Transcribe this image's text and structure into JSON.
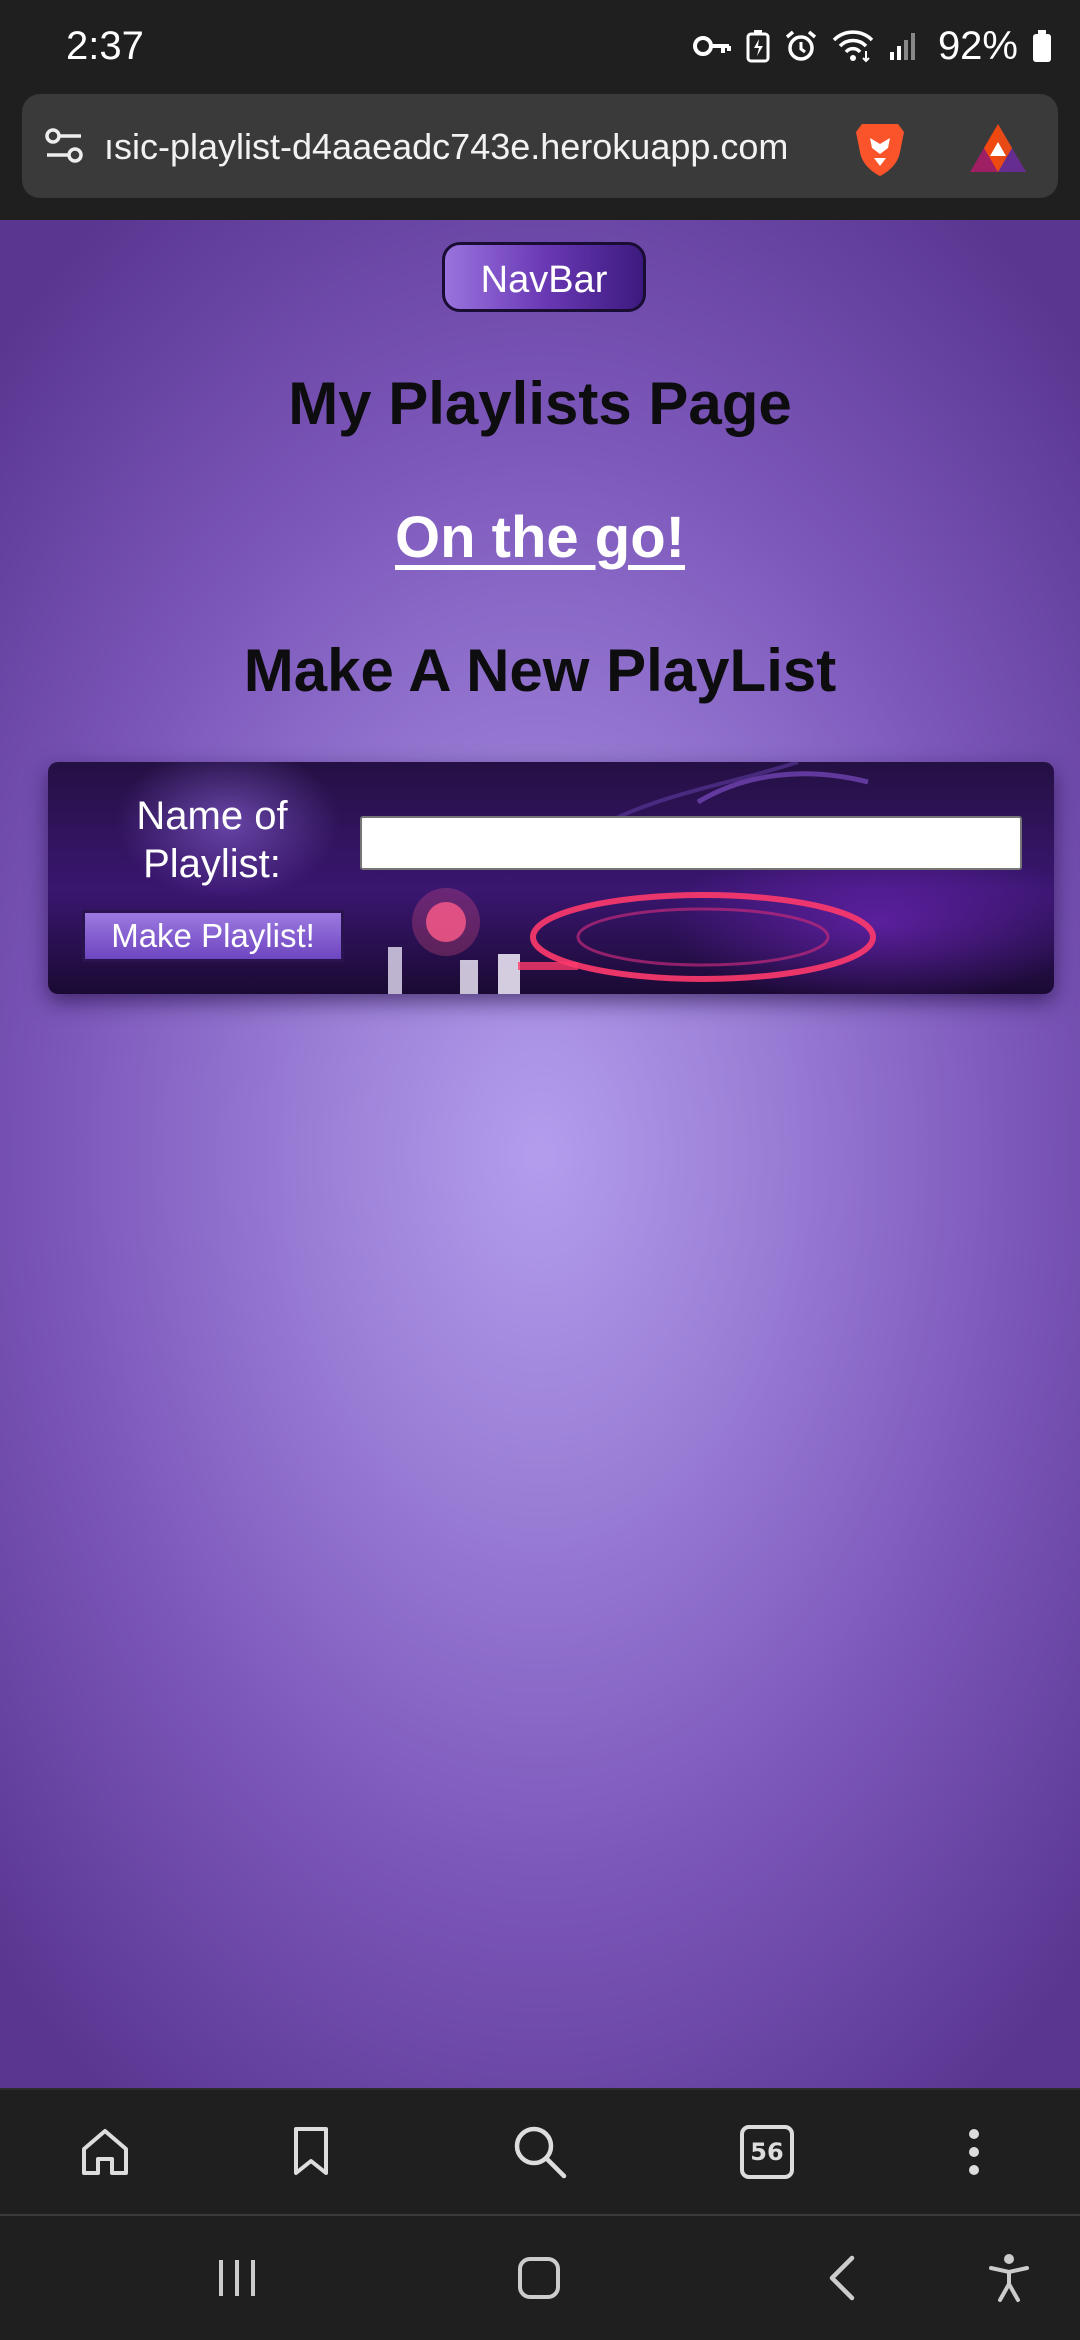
{
  "status_bar": {
    "time": "2:37",
    "battery_percent": "92%",
    "icons": [
      "key-icon",
      "battery-saver-icon",
      "alarm-icon",
      "wifi-icon",
      "cell-signal-icon",
      "battery-icon"
    ]
  },
  "browser": {
    "url": "ısic-playlist-d4aaeadc743e.herokuapp.com",
    "site_settings_icon": "tune-icon",
    "shields_icon": "brave-lion-icon",
    "rewards_icon": "brave-rewards-icon"
  },
  "page": {
    "nav_button": "NavBar",
    "title": "My Playlists Page",
    "subtitle_link": "On the go!",
    "section_heading": "Make A New PlayList",
    "form": {
      "name_label": "Name of Playlist:",
      "name_value": "",
      "submit_label": "Make Playlist!"
    }
  },
  "toolbar": {
    "items": [
      "home-icon",
      "bookmark-icon",
      "search-icon",
      "tabs-icon",
      "more-icon"
    ],
    "tab_count": "56"
  },
  "system_nav": {
    "items": [
      "recent-apps-icon",
      "home-button-icon",
      "back-icon",
      "accessibility-icon"
    ]
  },
  "colors": {
    "page_bg_center": "#b39ded",
    "page_bg_edge": "#5a3691",
    "heading_text": "#0d0d10",
    "chrome_bg": "#1f1f1f",
    "url_bar_bg": "#3a3a3a"
  }
}
